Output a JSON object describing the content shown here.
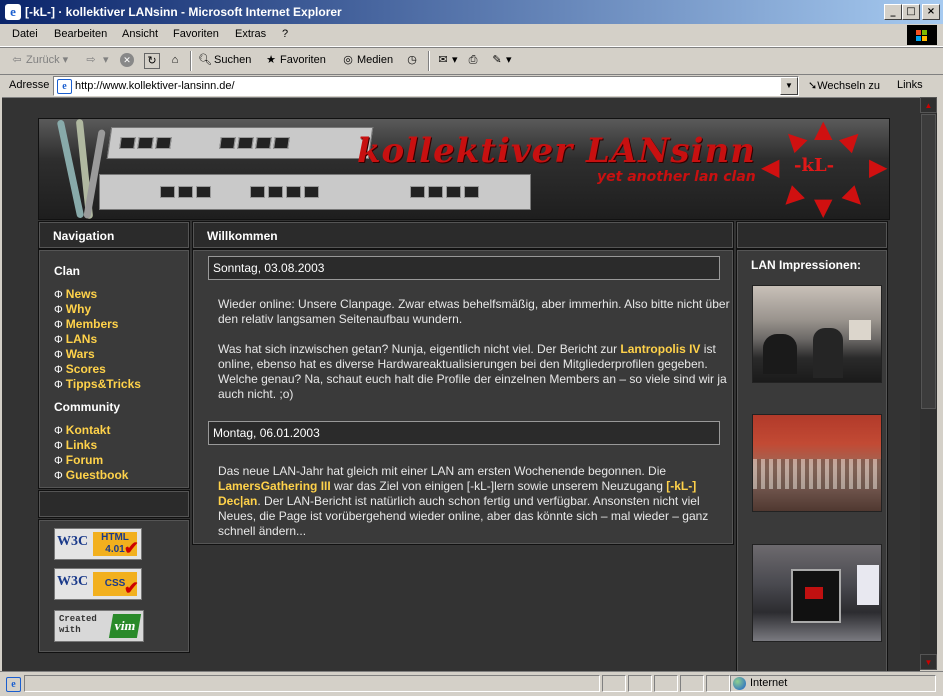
{
  "window": {
    "title": "[-kL-] · kollektiver LANsinn - Microsoft Internet Explorer",
    "controls": [
      "_",
      "□",
      "×"
    ]
  },
  "menu": [
    "Datei",
    "Bearbeiten",
    "Ansicht",
    "Favoriten",
    "Extras",
    "?"
  ],
  "toolbar": {
    "back": "Zurück",
    "search": "Suchen",
    "favorites": "Favoriten",
    "media": "Medien"
  },
  "address": {
    "label": "Adresse",
    "url": "http://www.kollektiver-lansinn.de/",
    "go": "Wechseln zu",
    "links": "Links"
  },
  "status": {
    "zone": "Internet"
  },
  "site": {
    "brand": "kollektiver LANsinn",
    "slogan": "yet another lan clan",
    "logo": "-kL-",
    "nav_title": "Navigation",
    "main_title": "Willkommen",
    "right_title": "LAN Impressionen:",
    "nav": [
      {
        "section": "Clan",
        "items": [
          "News",
          "Why",
          "Members",
          "LANs",
          "Wars",
          "Scores",
          "Tipps&Tricks"
        ]
      },
      {
        "section": "Community",
        "items": [
          "Kontakt",
          "Links",
          "Forum",
          "Guestbook"
        ]
      }
    ],
    "posts": [
      {
        "date": "Sonntag, 03.08.2003",
        "p1": "Wieder online: Unsere Clanpage. Zwar etwas behelfsmäßig, aber immerhin. Also bitte nicht über den relativ langsamen Seitenaufbau wundern.",
        "p2_before": "Was hat sich inzwischen getan? Nunja, eigentlich nicht viel. Der Bericht zur ",
        "p2_link": "Lantropolis IV",
        "p2_after": " ist online, ebenso hat es diverse Hardwareaktualisierungen bei den Mitgliederprofilen gegeben. Welche genau? Na, schaut euch halt die Profile der einzelnen Members an – so viele sind wir ja auch nicht. ;o)"
      },
      {
        "date": "Montag, 06.01.2003",
        "p1": "Das neue LAN-Jahr hat gleich mit einer LAN am ersten Wochenende begonnen. Die ",
        "link1": "LamersGathering III",
        "mid": " war das Ziel von einigen [-kL-]lern sowie unserem Neuzugang ",
        "link2": "[-kL-] Dec|an",
        "end": ". Der LAN-Bericht ist natürlich auch schon fertig und verfügbar. Ansonsten nicht viel Neues, die Page ist vorübergehend wieder online, aber das könnte sich – mal wieder – ganz schnell ändern..."
      }
    ],
    "badges": {
      "html": {
        "w3c": "W3C",
        "tag": "HTML 4.01"
      },
      "css": {
        "w3c": "W3C",
        "tag": "CSS"
      },
      "vim": {
        "text": "Created with",
        "logo": "vim"
      }
    }
  }
}
